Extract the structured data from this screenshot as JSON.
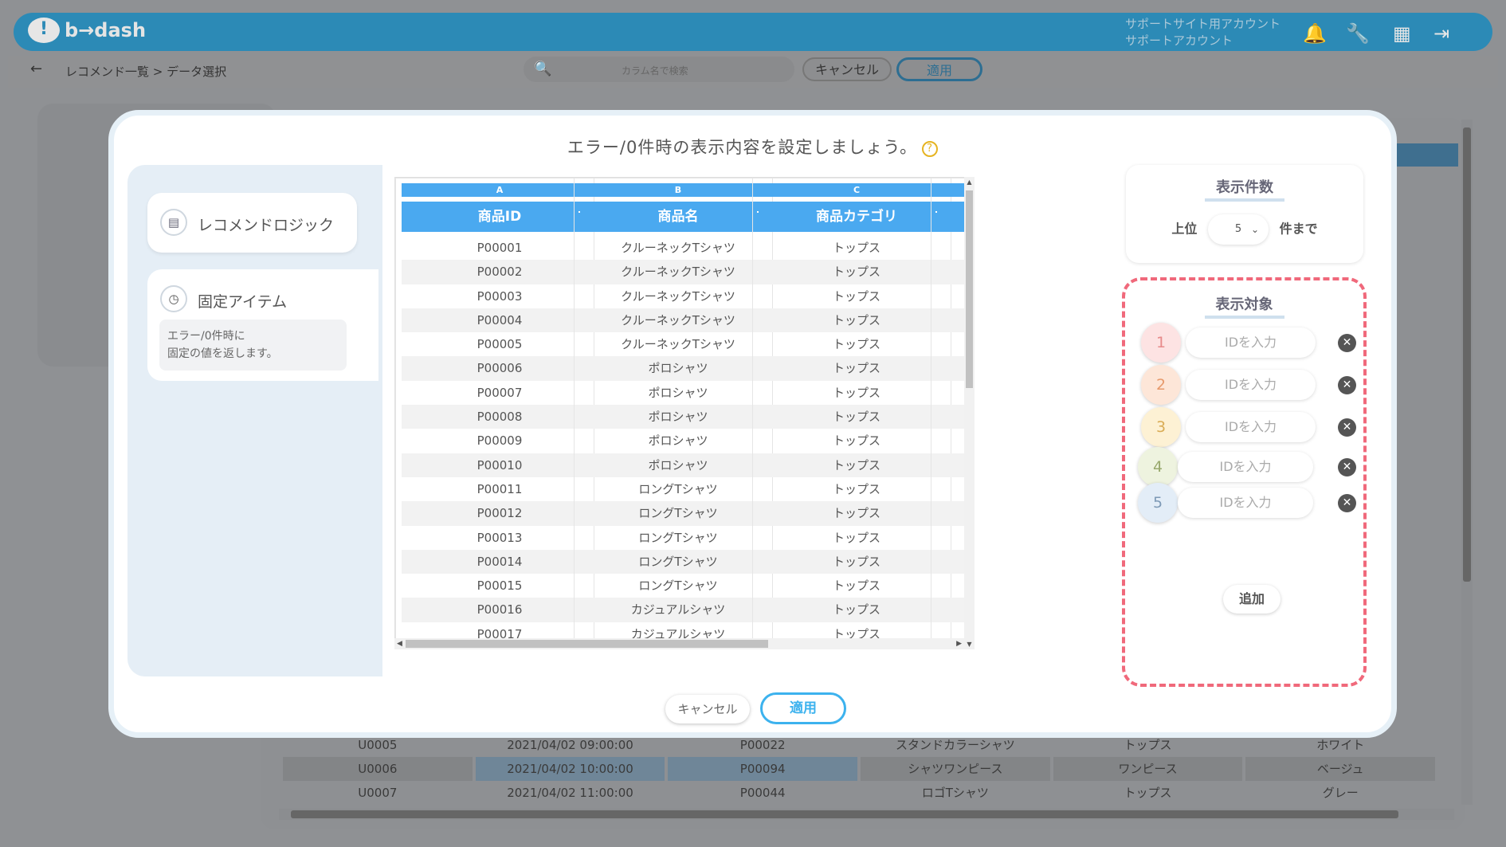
{
  "header": {
    "logo_text": "b→dash",
    "account_line1": "サポートサイト用アカウント",
    "account_line2": "サポートアカウント"
  },
  "subbar": {
    "back": "←",
    "breadcrumb": "レコメンド一覧  >  データ選択",
    "search_placeholder": "カラム名で検索",
    "cancel": "キャンセル",
    "apply": "適用"
  },
  "background_rows": [
    {
      "c1": "U0005",
      "c2": "2021/04/02 09:00:00",
      "c3": "P00022",
      "c4": "スタンドカラーシャツ",
      "c5": "トップス",
      "c6": "ホワイト"
    },
    {
      "c1": "U0006",
      "c2": "2021/04/02 10:00:00",
      "c3": "P00094",
      "c4": "シャツワンピース",
      "c5": "ワンピース",
      "c6": "ベージュ"
    },
    {
      "c1": "U0007",
      "c2": "2021/04/02 11:00:00",
      "c3": "P00044",
      "c4": "ロゴTシャツ",
      "c5": "トップス",
      "c6": "グレー"
    }
  ],
  "modal": {
    "title": "エラー/0件時の表示内容を設定しましょう。",
    "help": "?",
    "logic_card": {
      "icon": "📋",
      "label": "レコメンドロジック"
    },
    "fixed_card": {
      "icon": "🕓",
      "label": "固定アイテム",
      "desc_line1": "エラー/0件時に",
      "desc_line2": "固定の値を返します。"
    },
    "columns": [
      {
        "letter": "A",
        "header": "商品ID"
      },
      {
        "letter": "B",
        "header": "商品名"
      },
      {
        "letter": "C",
        "header": "商品カテゴリ"
      },
      {
        "letter": "",
        "header": ""
      }
    ],
    "rows": [
      [
        "P00001",
        "クルーネックTシャツ",
        "トップス"
      ],
      [
        "P00002",
        "クルーネックTシャツ",
        "トップス"
      ],
      [
        "P00003",
        "クルーネックTシャツ",
        "トップス"
      ],
      [
        "P00004",
        "クルーネックTシャツ",
        "トップス"
      ],
      [
        "P00005",
        "クルーネックTシャツ",
        "トップス"
      ],
      [
        "P00006",
        "ポロシャツ",
        "トップス"
      ],
      [
        "P00007",
        "ポロシャツ",
        "トップス"
      ],
      [
        "P00008",
        "ポロシャツ",
        "トップス"
      ],
      [
        "P00009",
        "ポロシャツ",
        "トップス"
      ],
      [
        "P00010",
        "ポロシャツ",
        "トップス"
      ],
      [
        "P00011",
        "ロングTシャツ",
        "トップス"
      ],
      [
        "P00012",
        "ロングTシャツ",
        "トップス"
      ],
      [
        "P00013",
        "ロングTシャツ",
        "トップス"
      ],
      [
        "P00014",
        "ロングTシャツ",
        "トップス"
      ],
      [
        "P00015",
        "ロングTシャツ",
        "トップス"
      ],
      [
        "P00016",
        "カジュアルシャツ",
        "トップス"
      ],
      [
        "P00017",
        "カジュアルシャツ",
        "トップス"
      ]
    ],
    "count": {
      "title": "表示件数",
      "prefix": "上位",
      "value": "5",
      "suffix": "件まで"
    },
    "target": {
      "title": "表示対象",
      "placeholder": "IDを入力",
      "items": [
        {
          "num": "1",
          "bg": "#fde3e3",
          "color": "#e78b8b"
        },
        {
          "num": "2",
          "bg": "#fde6d8",
          "color": "#e79a6c"
        },
        {
          "num": "3",
          "bg": "#fdf1d4",
          "color": "#d9ac55"
        },
        {
          "num": "4",
          "bg": "#eef3df",
          "color": "#98a86c"
        },
        {
          "num": "5",
          "bg": "#e3edf7",
          "color": "#7e9ab6"
        }
      ],
      "add": "追加"
    },
    "cancel": "キャンセル",
    "apply": "適用"
  },
  "colors": {
    "accent": "#4aa9f0",
    "apply_border": "#3cb2ee",
    "highlight_dash": "#f0697b"
  }
}
